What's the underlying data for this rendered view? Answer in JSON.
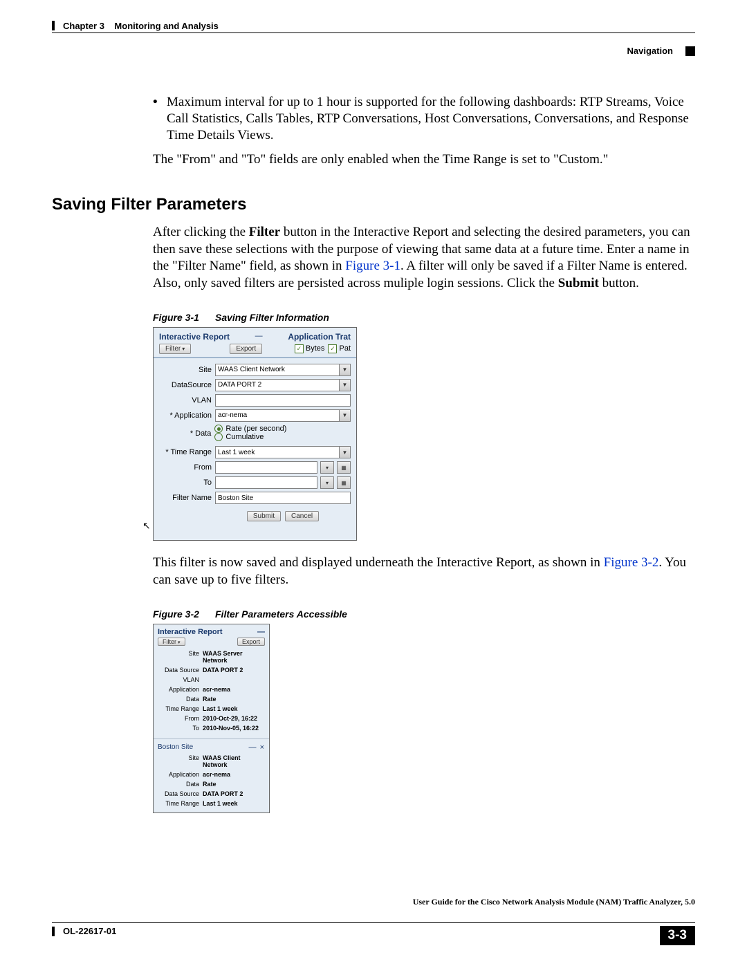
{
  "header": {
    "chapter_label": "Chapter 3",
    "chapter_title": "Monitoring and Analysis",
    "nav_label": "Navigation"
  },
  "body": {
    "bullet1": "Maximum interval for up to 1 hour is supported for the following dashboards: RTP Streams, Voice Call Statistics, Calls Tables, RTP Conversations, Host Conversations, Conversations, and Response Time Details Views.",
    "para1": "The \"From\" and \"To\" fields are only enabled when the Time Range is set to \"Custom.\"",
    "heading": "Saving Filter Parameters",
    "para2_a": "After clicking the ",
    "para2_b_bold": "Filter",
    "para2_c": " button in the Interactive Report and selecting the desired parameters, you can then save these selections with the purpose of viewing that same data at a future time. Enter a name in the \"Filter Name\" field, as shown in ",
    "para2_link": "Figure 3-1",
    "para2_d": ". A filter will only be saved if a Filter Name is entered. Also, only saved filters are persisted across muliple login sessions. Click the ",
    "para2_e_bold": "Submit",
    "para2_f": " button.",
    "para3_a": "This filter is now saved and displayed underneath the Interactive Report, as shown in ",
    "para3_link": "Figure 3-2",
    "para3_b": ". You can save up to five filters."
  },
  "figures": {
    "fig1": {
      "label": "Figure 3-1",
      "caption": "Saving Filter Information",
      "interactive_report_title": "Interactive Report",
      "app_trat": "Application Trat",
      "filter_btn": "Filter",
      "export_btn": "Export",
      "bytes_label": "Bytes",
      "pa_label": "Pat",
      "labels": {
        "site": "Site",
        "datasource": "DataSource",
        "vlan": "VLAN",
        "application": "* Application",
        "data": "* Data",
        "timerange": "* Time Range",
        "from": "From",
        "to": "To",
        "filtername": "Filter Name"
      },
      "values": {
        "site": "WAAS Client Network",
        "datasource": "DATA PORT 2",
        "vlan": "",
        "application": "acr-nema",
        "radio_rate": "Rate (per second)",
        "radio_cumulative": "Cumulative",
        "timerange": "Last 1 week",
        "filtername": "Boston Site"
      },
      "submit_btn": "Submit",
      "cancel_btn": "Cancel"
    },
    "fig2": {
      "label": "Figure 3-2",
      "caption": "Filter Parameters Accessible",
      "interactive_report_title": "Interactive Report",
      "filter_btn": "Filter",
      "export_btn": "Export",
      "report": {
        "site": "WAAS Server Network",
        "datasource": "DATA PORT 2",
        "vlan": "",
        "application": "acr-nema",
        "data": "Rate",
        "timerange": "Last 1 week",
        "from": "2010-Oct-29, 16:22",
        "to": "2010-Nov-05, 16:22"
      },
      "saved_title": "Boston Site",
      "saved": {
        "site": "WAAS Client Network",
        "application": "acr-nema",
        "data": "Rate",
        "datasource": "DATA PORT 2",
        "timerange": "Last 1 week"
      },
      "labels": {
        "site": "Site",
        "datasource": "Data Source",
        "vlan": "VLAN",
        "application": "Application",
        "data": "Data",
        "timerange": "Time Range",
        "from": "From",
        "to": "To"
      }
    }
  },
  "footer": {
    "guide_title": "User Guide for the Cisco Network Analysis Module (NAM) Traffic Analyzer, 5.0",
    "doc_id": "OL-22617-01",
    "page_num": "3-3"
  }
}
